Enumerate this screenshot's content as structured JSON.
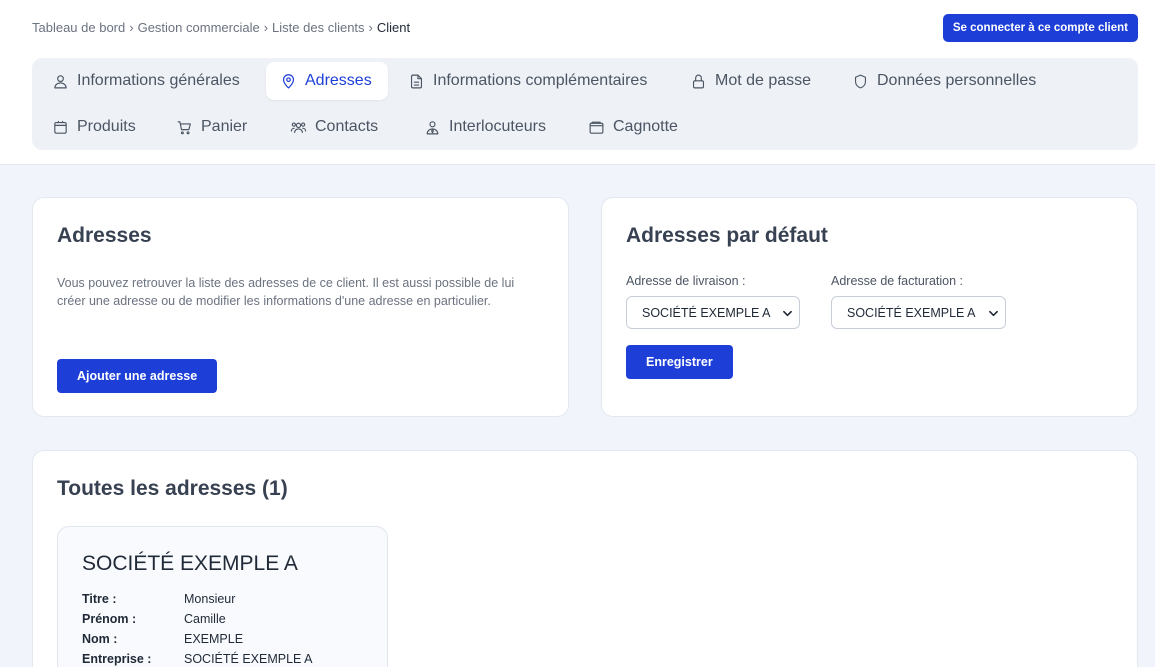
{
  "breadcrumb": {
    "items": [
      "Tableau de bord",
      "Gestion commerciale",
      "Liste des clients"
    ],
    "separator": "›",
    "current": "Client"
  },
  "header": {
    "connect_button": "Se connecter à ce compte client"
  },
  "tabs": [
    {
      "label": "Informations générales",
      "icon": "user-icon",
      "active": false
    },
    {
      "label": "Adresses",
      "icon": "map-pin-icon",
      "active": true
    },
    {
      "label": "Informations complémentaires",
      "icon": "document-icon",
      "active": false
    },
    {
      "label": "Mot de passe",
      "icon": "lock-icon",
      "active": false
    },
    {
      "label": "Données personnelles",
      "icon": "shield-icon",
      "active": false
    },
    {
      "label": "Produits",
      "icon": "box-icon",
      "active": false
    },
    {
      "label": "Panier",
      "icon": "cart-icon",
      "active": false
    },
    {
      "label": "Contacts",
      "icon": "users-icon",
      "active": false
    },
    {
      "label": "Interlocuteurs",
      "icon": "user-tie-icon",
      "active": false
    },
    {
      "label": "Cagnotte",
      "icon": "wallet-icon",
      "active": false
    }
  ],
  "addresses_card": {
    "title": "Adresses",
    "description": "Vous pouvez retrouver la liste des adresses de ce client. Il est aussi possible de lui créer une adresse ou de modifier les informations d'une adresse en particulier.",
    "add_button": "Ajouter une adresse"
  },
  "default_card": {
    "title": "Adresses par défaut",
    "delivery_label": "Adresse de livraison :",
    "delivery_value": "SOCIÉTÉ EXEMPLE A",
    "billing_label": "Adresse de facturation :",
    "billing_value": "SOCIÉTÉ EXEMPLE A",
    "save_button": "Enregistrer"
  },
  "all_addresses": {
    "title": "Toutes les adresses (1)",
    "items": [
      {
        "name": "SOCIÉTÉ EXEMPLE A",
        "fields": [
          {
            "label": "Titre :",
            "value": "Monsieur"
          },
          {
            "label": "Prénom :",
            "value": "Camille"
          },
          {
            "label": "Nom :",
            "value": "EXEMPLE"
          },
          {
            "label": "Entreprise :",
            "value": "SOCIÉTÉ EXEMPLE A"
          }
        ]
      }
    ]
  },
  "colors": {
    "accent": "#1d3fd8",
    "page_background": "#f1f5fb",
    "tabs_background": "#eef1f6"
  }
}
